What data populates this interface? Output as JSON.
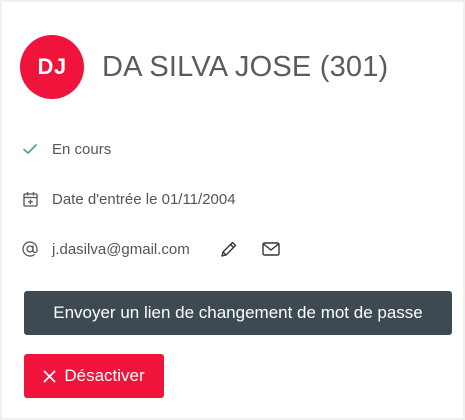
{
  "profile": {
    "initials": "DJ",
    "name": "DA SILVA JOSE (301)"
  },
  "status": {
    "icon": "check-icon",
    "text": "En cours"
  },
  "entry_date": {
    "icon": "calendar-plus-icon",
    "text": "Date d'entrée le 01/11/2004"
  },
  "email": {
    "icon": "at-icon",
    "address": "j.dasilva@gmail.com",
    "edit_icon": "pencil-icon",
    "mail_icon": "envelope-icon"
  },
  "actions": {
    "reset_password_label": "Envoyer un lien de changement de mot de passe",
    "deactivate_label": "Désactiver",
    "deactivate_icon": "close-icon"
  },
  "colors": {
    "accent": "#f0143c",
    "danger": "#f0143c",
    "success": "#3daa7a",
    "dark_button": "#3d4a52"
  }
}
